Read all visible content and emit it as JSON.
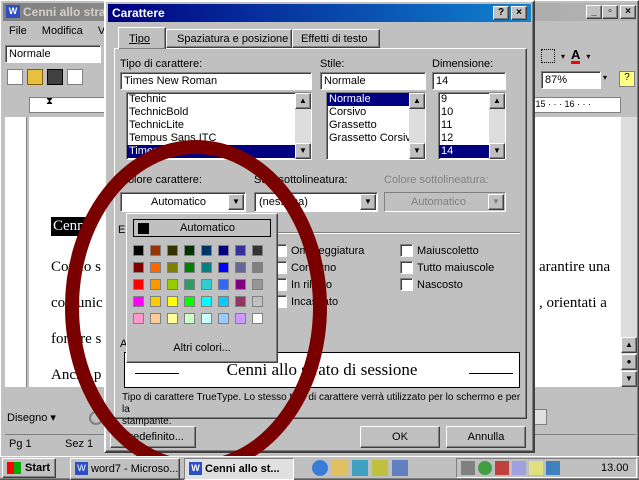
{
  "word": {
    "title": "Cenni allo strat",
    "menu": [
      "File",
      "Modifica",
      "Visu"
    ],
    "style_box": "Normale",
    "zoom": "87%",
    "doc_heading": "Cenni",
    "doc_lines": [
      "Con lo s",
      "comunic",
      "fornire s",
      "Anche p"
    ],
    "doc_right": [
      "arantire una",
      ", orientati a"
    ],
    "ruler_right": "· 15 · · · 16 · · ·",
    "draw_label": "Disegno ▾",
    "status": {
      "page": "Pg 1",
      "sec": "Sez 1"
    }
  },
  "dialog": {
    "title": "Carattere",
    "help_btn": "?",
    "close_btn": "×",
    "tabs": [
      "Tipo",
      "Spaziatura e posizione",
      "Effetti di testo"
    ],
    "font_label": "Tipo di carattere:",
    "font_value": "Times New Roman",
    "font_list": [
      "Technic",
      "TechnicBold",
      "TechnicLite",
      "Tempus Sans ITC",
      "Times New Roman"
    ],
    "style_label": "Stile:",
    "style_value": "Normale",
    "style_list": [
      "Normale",
      "Corsivo",
      "Grassetto",
      "Grassetto Corsivo"
    ],
    "size_label": "Dimensione:",
    "size_value": "14",
    "size_list": [
      "9",
      "10",
      "11",
      "12",
      "14"
    ],
    "color_label": "Colore carattere:",
    "color_value": "Automatico",
    "underline_label": "Stile sottolineatura:",
    "underline_value": "(nessuna)",
    "underline_color_label": "Colore sottolineatura:",
    "underline_color_value": "Automatico",
    "effects_letter": "E",
    "effects": [
      "Ombreggiatura",
      "Contorno",
      "In rilievo",
      "Incassato"
    ],
    "effects2": [
      "Maiuscoletto",
      "Tutto maiuscole",
      "Nascosto"
    ],
    "preview_letter": "A",
    "preview_text": "Cenni allo strato di sessione",
    "info_line1": "Tipo di carattere TrueType. Lo stesso tipo di carattere verrà utilizzato per lo schermo e per la",
    "info_line2": "stampante.",
    "default_btn": "Predefinito...",
    "ok_btn": "OK",
    "cancel_btn": "Annulla"
  },
  "palette": {
    "auto": "Automatico",
    "more": "Altri colori...",
    "rows": [
      [
        "#000000",
        "#993300",
        "#333300",
        "#003300",
        "#003366",
        "#000080",
        "#333399",
        "#333333"
      ],
      [
        "#800000",
        "#ff6600",
        "#808000",
        "#008000",
        "#008080",
        "#0000ff",
        "#666699",
        "#808080"
      ],
      [
        "#ff0000",
        "#ff9900",
        "#99cc00",
        "#339966",
        "#33cccc",
        "#3366ff",
        "#800080",
        "#969696"
      ],
      [
        "#ff00ff",
        "#ffcc00",
        "#ffff00",
        "#00ff00",
        "#00ffff",
        "#00ccff",
        "#993366",
        "#c0c0c0"
      ],
      [
        "#ff99cc",
        "#ffcc99",
        "#ffff99",
        "#ccffcc",
        "#ccffff",
        "#99ccff",
        "#cc99ff",
        "#ffffff"
      ]
    ]
  },
  "taskbar": {
    "start": "Start",
    "tasks": [
      "word7 - Microso...",
      "Cenni allo st..."
    ],
    "clock": "13.00"
  },
  "annotation_color": "#7a0000"
}
